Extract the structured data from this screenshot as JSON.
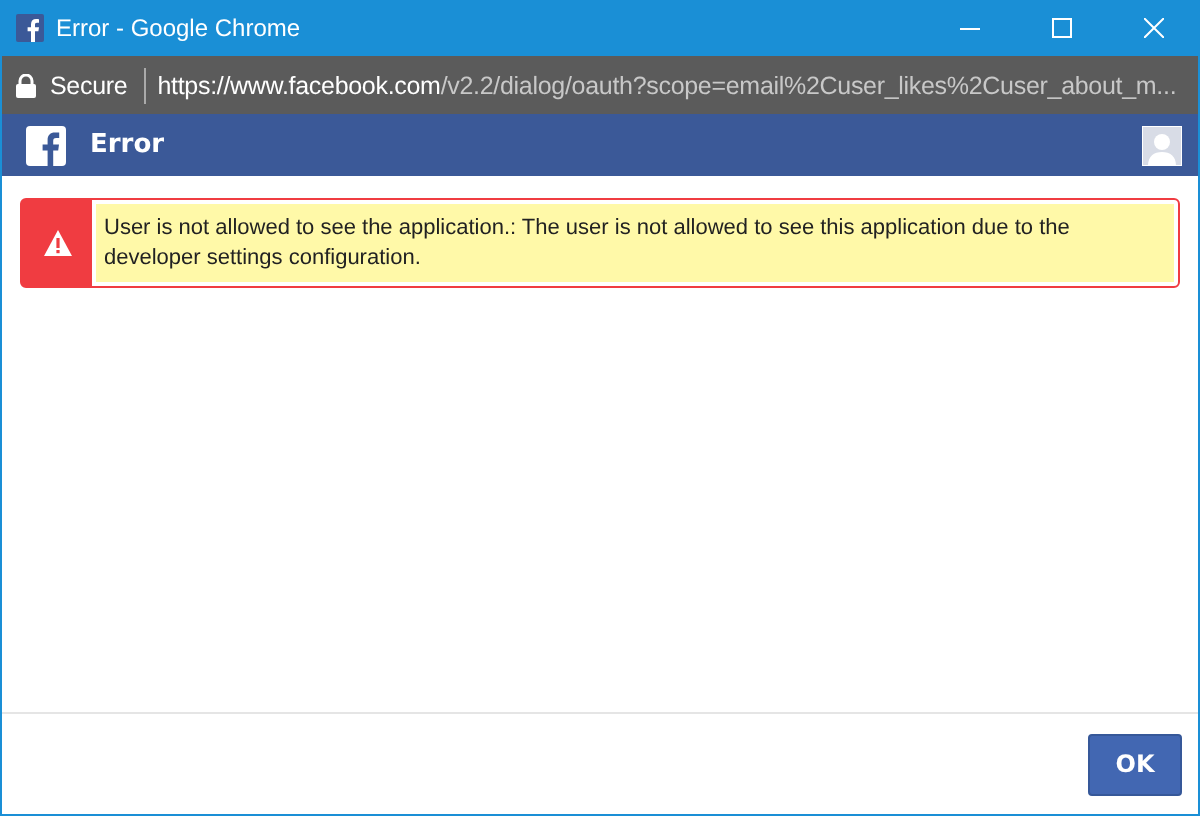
{
  "window": {
    "title": "Error - Google Chrome"
  },
  "address_bar": {
    "security": "Secure",
    "url_host": "https://www.facebook.com",
    "url_path": "/v2.2/dialog/oauth?scope=email%2Cuser_likes%2Cuser_about_m..."
  },
  "dialog": {
    "title": "Error",
    "message": "User is not allowed to see the application.: The user is not allowed to see this application due to the developer settings configuration.",
    "buttons": [
      "OK"
    ]
  }
}
